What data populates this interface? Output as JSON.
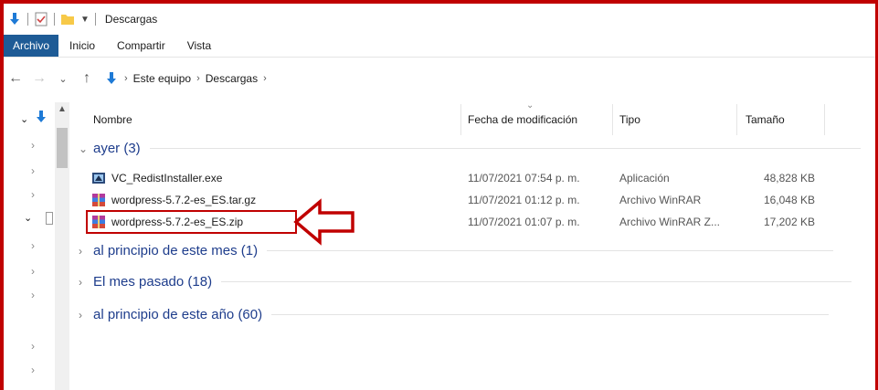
{
  "window": {
    "title": "Descargas",
    "frame_color": "#c00000"
  },
  "ribbon": {
    "tabs": [
      "Archivo",
      "Inicio",
      "Compartir",
      "Vista"
    ],
    "accent": "#1e5b96"
  },
  "address": {
    "crumbs": [
      "Este equipo",
      "Descargas"
    ]
  },
  "columns": {
    "name": "Nombre",
    "date": "Fecha de modificación",
    "type": "Tipo",
    "size": "Tamaño"
  },
  "groups": [
    {
      "label": "ayer (3)",
      "expanded": true,
      "files": [
        {
          "name": "VC_RedistInstaller.exe",
          "date": "11/07/2021 07:54 p. m.",
          "type": "Aplicación",
          "size": "48,828 KB",
          "icon": "installer-icon"
        },
        {
          "name": "wordpress-5.7.2-es_ES.tar.gz",
          "date": "11/07/2021 01:12 p. m.",
          "type": "Archivo WinRAR",
          "size": "16,048 KB",
          "icon": "winrar-icon"
        },
        {
          "name": "wordpress-5.7.2-es_ES.zip",
          "date": "11/07/2021 01:07 p. m.",
          "type": "Archivo WinRAR Z...",
          "size": "17,202 KB",
          "icon": "winrar-icon",
          "highlighted": true
        }
      ]
    },
    {
      "label": "al principio de este mes (1)",
      "expanded": false
    },
    {
      "label": "El mes pasado (18)",
      "expanded": false
    },
    {
      "label": "al principio de este año (60)",
      "expanded": false
    }
  ],
  "annotation": {
    "type": "arrow-pointing-left",
    "color": "#c00000"
  }
}
